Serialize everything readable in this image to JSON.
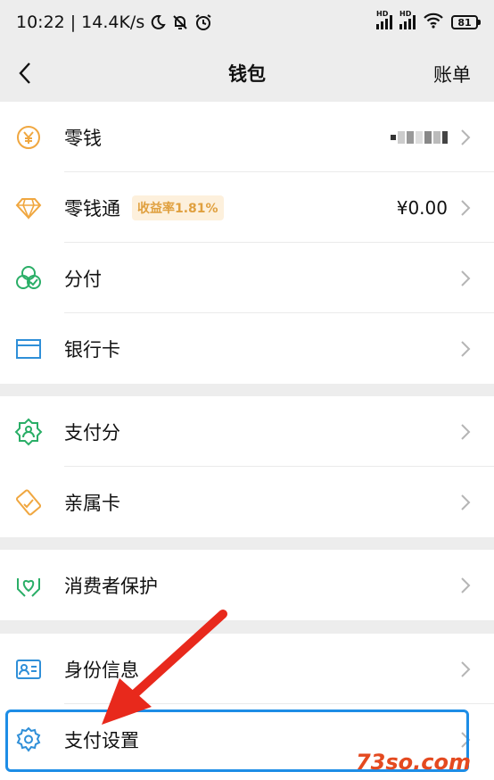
{
  "status": {
    "time": "10:22",
    "speed": "14.4K/s",
    "battery": "81",
    "hd1": "HD",
    "hd2": "HD"
  },
  "nav": {
    "title": "钱包",
    "bill": "账单"
  },
  "rows": [
    {
      "label": "零钱",
      "icon": "yuan-coin-icon"
    },
    {
      "label": "零钱通",
      "badge": "收益率1.81%",
      "value": "¥0.00",
      "icon": "diamond-icon"
    },
    {
      "label": "分付",
      "icon": "fenfu-icon"
    },
    {
      "label": "银行卡",
      "icon": "bank-card-icon"
    },
    {
      "label": "支付分",
      "icon": "payscore-icon"
    },
    {
      "label": "亲属卡",
      "icon": "family-card-icon"
    },
    {
      "label": "消费者保护",
      "icon": "consumer-protection-icon"
    },
    {
      "label": "身份信息",
      "icon": "id-card-icon"
    },
    {
      "label": "支付设置",
      "icon": "gear-icon"
    }
  ],
  "watermark": "73so.com",
  "colors": {
    "background": "#ededed",
    "orange": "#f0a740",
    "green": "#2aae67",
    "blue": "#2f8fd8",
    "highlight": "#1d8de6",
    "arrow": "#e8291c"
  }
}
